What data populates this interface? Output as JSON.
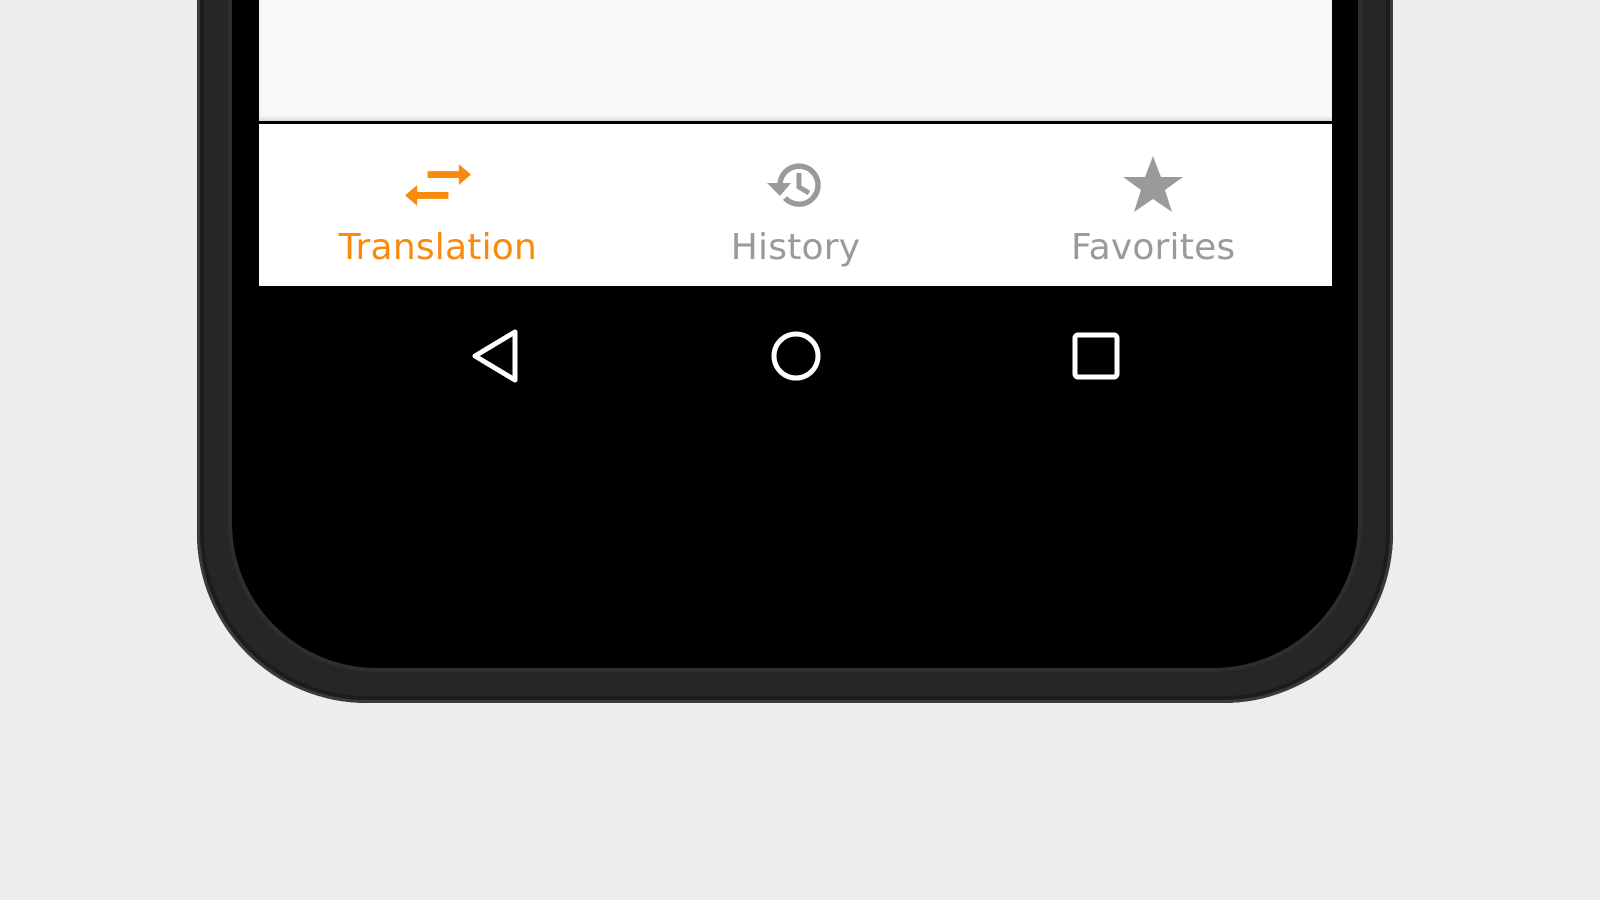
{
  "bottom_nav": {
    "items": [
      {
        "label": "Translation",
        "icon": "swap-arrows-icon",
        "active": true
      },
      {
        "label": "History",
        "icon": "history-icon",
        "active": false
      },
      {
        "label": "Favorites",
        "icon": "star-icon",
        "active": false
      }
    ]
  },
  "system_nav": {
    "buttons": [
      {
        "icon": "back-triangle-icon"
      },
      {
        "icon": "home-circle-icon"
      },
      {
        "icon": "recents-square-icon"
      }
    ]
  },
  "colors": {
    "accent": "#F98A0C",
    "inactive": "#9A9A9A",
    "background": "#ECEDEF"
  }
}
